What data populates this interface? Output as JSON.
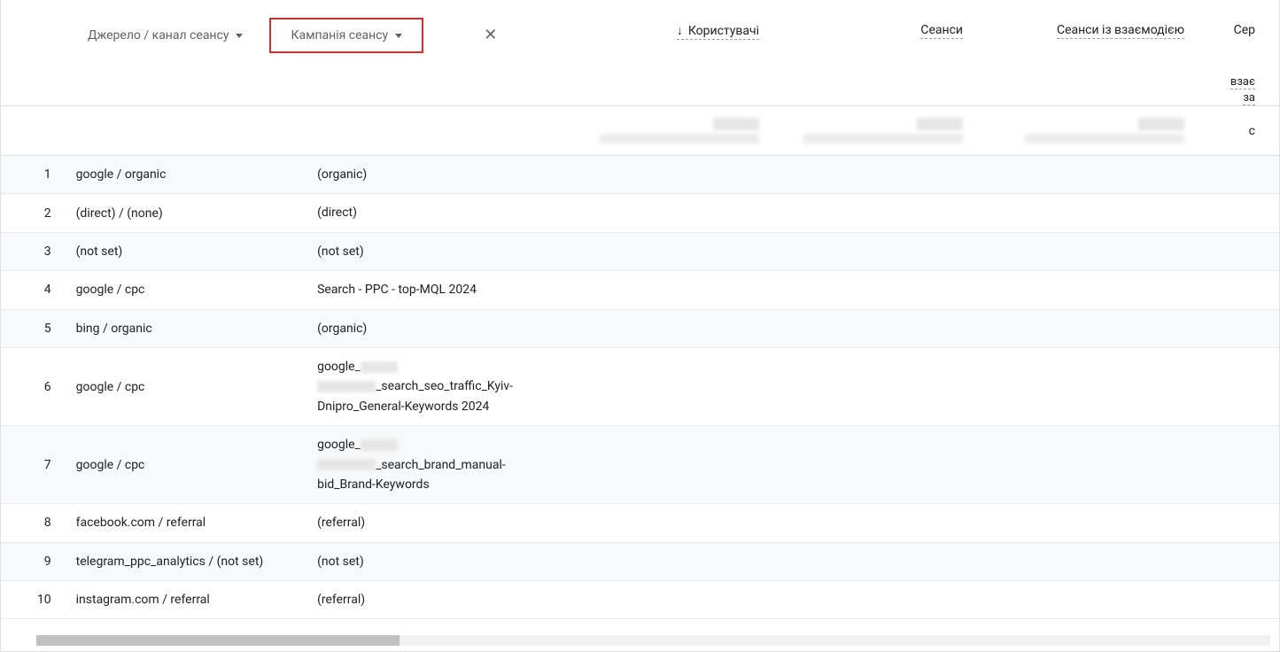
{
  "dimensions": {
    "primary": "Джерело / канал сеансу",
    "secondary": "Кампанія сеансу"
  },
  "close_icon": "✕",
  "metrics": {
    "users": "Користувачі",
    "sessions": "Сеанси",
    "engaged": "Сеанси із взаємодією",
    "partial": "Сер",
    "partial_sub1": "взає",
    "partial_sub2": "за"
  },
  "summary_last_char": "с",
  "rows": [
    {
      "idx": "1",
      "source": "google / organic",
      "campaign": "(organic)"
    },
    {
      "idx": "2",
      "source": "(direct) / (none)",
      "campaign": "(direct)"
    },
    {
      "idx": "3",
      "source": "(not set)",
      "campaign": "(not set)"
    },
    {
      "idx": "4",
      "source": "google / cpc",
      "campaign": "Search - PPC - top-MQL 2024"
    },
    {
      "idx": "5",
      "source": "bing / organic",
      "campaign": "(organic)"
    },
    {
      "idx": "6",
      "source": "google / cpc",
      "campaign_pre": "google_",
      "campaign_mid": "_search_seo_traffic_Kyiv-Dnipro_General-Keywords 2024"
    },
    {
      "idx": "7",
      "source": "google / cpc",
      "campaign_pre": "google_",
      "campaign_mid": "_search_brand_manual-bid_Brand-Keywords"
    },
    {
      "idx": "8",
      "source": "facebook.com / referral",
      "campaign": "(referral)"
    },
    {
      "idx": "9",
      "source": "telegram_ppc_analytics / (not set)",
      "campaign": "(not set)"
    },
    {
      "idx": "10",
      "source": "instagram.com / referral",
      "campaign": "(referral)"
    }
  ]
}
